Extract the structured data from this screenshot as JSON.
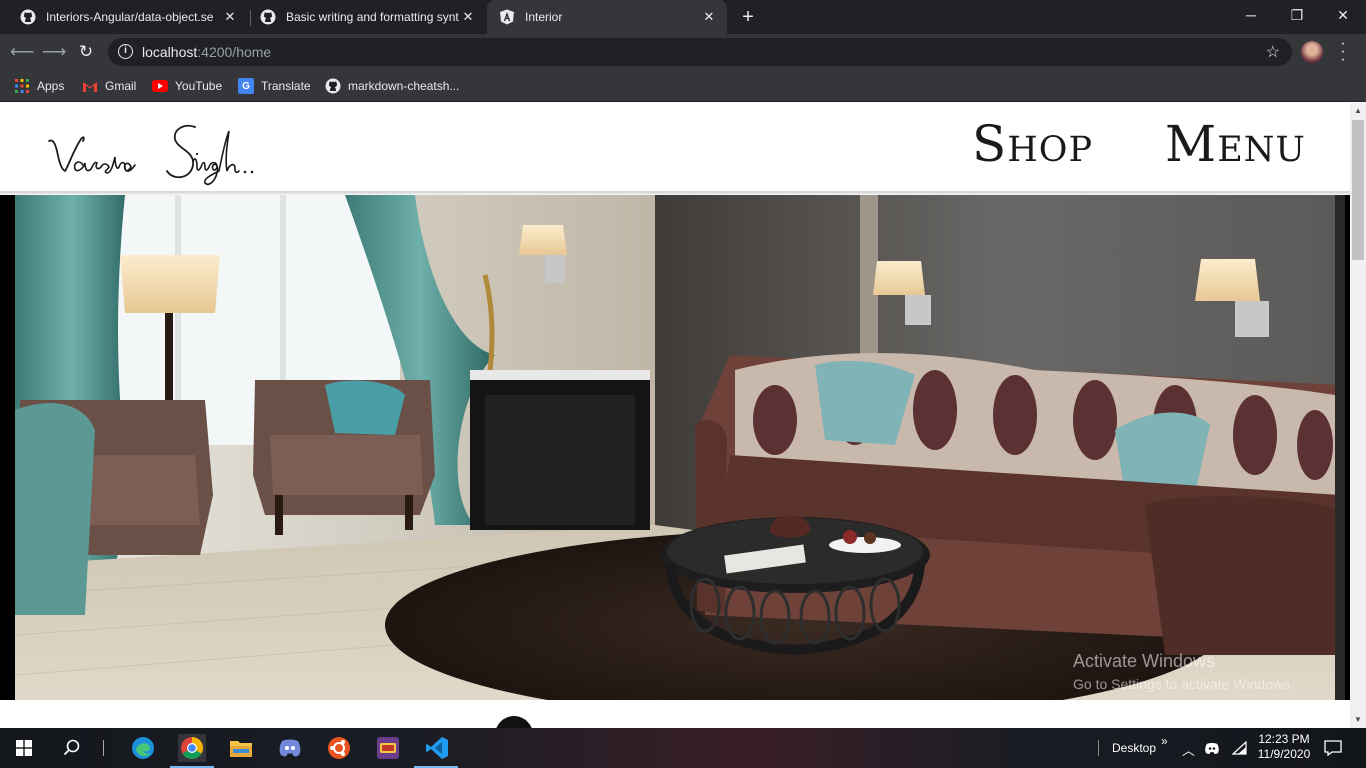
{
  "browser": {
    "tabs": [
      {
        "title": "Interiors-Angular/data-object.se",
        "icon": "github-icon",
        "active": false
      },
      {
        "title": "Basic writing and formatting synt",
        "icon": "github-icon",
        "active": false
      },
      {
        "title": "Interior",
        "icon": "angular-icon",
        "active": true
      }
    ],
    "url_host": "localhost",
    "url_rest": ":4200/home",
    "bookmarks": [
      "Apps",
      "Gmail",
      "YouTube",
      "Translate",
      "markdown-cheatsh..."
    ]
  },
  "site": {
    "logo_text": "Varsha Singh..",
    "nav": {
      "shop": "Shop",
      "menu": "Menu"
    },
    "hero_alt": "Living room interior with sofa, armchairs and lamps"
  },
  "watermark": {
    "line1": "Activate Windows",
    "line2": "Go to Settings to activate Windows."
  },
  "taskbar": {
    "desktop_label": "Desktop",
    "time": "12:23 PM",
    "date": "11/9/2020"
  },
  "colors": {
    "chrome_dark": "#202124",
    "chrome_toolbar": "#35363a",
    "taskbar_accent": "#76b9ed"
  }
}
